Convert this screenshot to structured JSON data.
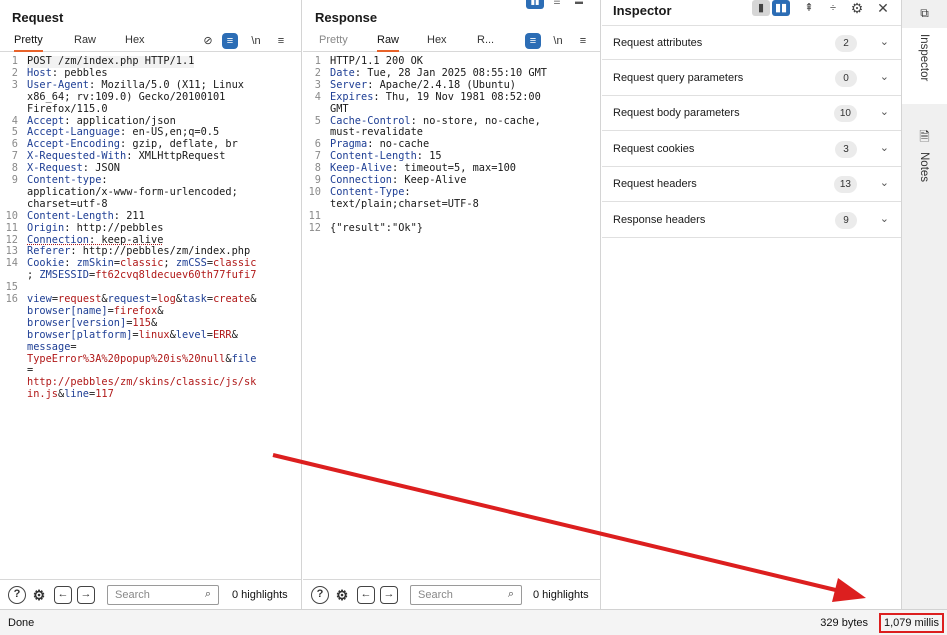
{
  "request": {
    "title": "Request",
    "tabs": [
      "Pretty",
      "Raw",
      "Hex"
    ],
    "tools": {
      "newline": "\\n",
      "menu": "≡"
    },
    "lines": [
      {
        "n": "1",
        "html": "POST /zm/index.php HTTP/1.1"
      },
      {
        "n": "2",
        "html": "<span class='k'>Host</span>: pebbles"
      },
      {
        "n": "3",
        "html": "<span class='k'>User-Agent</span>: Mozilla/5.0 (X11; Linux"
      },
      {
        "n": "",
        "html": "x86_64; rv:109.0) Gecko/20100101"
      },
      {
        "n": "",
        "html": "Firefox/115.0"
      },
      {
        "n": "4",
        "html": "<span class='k'>Accept</span>: application/json"
      },
      {
        "n": "5",
        "html": "<span class='k'>Accept-Language</span>: en-US,en;q=0.5"
      },
      {
        "n": "6",
        "html": "<span class='k'>Accept-Encoding</span>: gzip, deflate, br"
      },
      {
        "n": "7",
        "html": "<span class='k'>X-Requested-With</span>: XMLHttpRequest"
      },
      {
        "n": "8",
        "html": "<span class='k'>X-Request</span>: JSON"
      },
      {
        "n": "9",
        "html": "<span class='k'>Content-type</span>:"
      },
      {
        "n": "",
        "html": "application/x-www-form-urlencoded;"
      },
      {
        "n": "",
        "html": "charset=utf-8"
      },
      {
        "n": "10",
        "html": "<span class='k'>Content-Length</span>: 211"
      },
      {
        "n": "11",
        "html": "<span class='k'>Origin</span>: http://pebbles"
      },
      {
        "n": "12",
        "html": "<span class='k ul'>Connection</span><span class='ul'>: keep-alive</span>"
      },
      {
        "n": "13",
        "html": "<span class='k'>Referer</span>: http://pebbles/zm/index.php"
      },
      {
        "n": "14",
        "html": "<span class='k'>Cookie</span>: <span class='k'>zmSkin</span>=<span class='r'>classic</span>; <span class='k'>zmCSS</span>=<span class='r'>classic</span>"
      },
      {
        "n": "",
        "html": "; <span class='k'>ZMSESSID</span>=<span class='r'>ft62cvq8ldecuev60th77fufi7</span>"
      },
      {
        "n": "15",
        "html": ""
      },
      {
        "n": "16",
        "html": "<span class='k'>view</span>=<span class='r'>request</span>&amp;<span class='k'>request</span>=<span class='r'>log</span>&amp;<span class='k'>task</span>=<span class='r'>create</span>&amp;"
      },
      {
        "n": "",
        "html": "<span class='k'>browser[name]</span>=<span class='r'>firefox</span>&amp;"
      },
      {
        "n": "",
        "html": "<span class='k'>browser[version]</span>=<span class='r'>115</span>&amp;"
      },
      {
        "n": "",
        "html": "<span class='k'>browser[platform]</span>=<span class='r'>linux</span>&amp;<span class='k'>level</span>=<span class='r'>ERR</span>&amp;"
      },
      {
        "n": "",
        "html": "<span class='k'>message</span>="
      },
      {
        "n": "",
        "html": "<span class='r'>TypeError%3A%20popup%20is%20null</span>&amp;<span class='k'>file</span>"
      },
      {
        "n": "",
        "html": "="
      },
      {
        "n": "",
        "html": "<span class='r'>http://pebbles/zm/skins/classic/js/sk</span>"
      },
      {
        "n": "",
        "html": "<span class='r'>in.js</span>&amp;<span class='k'>line</span>=<span class='r'>117</span>"
      }
    ],
    "search_placeholder": "Search",
    "highlights": "0 highlights"
  },
  "response": {
    "title": "Response",
    "tabs": [
      "Pretty",
      "Raw",
      "Hex",
      "R..."
    ],
    "tools": {
      "newline": "\\n",
      "menu": "≡"
    },
    "lines": [
      {
        "n": "1",
        "html": "HTTP/1.1 200 OK"
      },
      {
        "n": "2",
        "html": "<span class='k'>Date</span>: Tue, 28 Jan 2025 08:55:10 GMT"
      },
      {
        "n": "3",
        "html": "<span class='k'>Server</span>: Apache/2.4.18 (Ubuntu)"
      },
      {
        "n": "4",
        "html": "<span class='k'>Expires</span>: Thu, 19 Nov 1981 08:52:00"
      },
      {
        "n": "",
        "html": "GMT"
      },
      {
        "n": "5",
        "html": "<span class='k'>Cache-Control</span>: no-store, no-cache,"
      },
      {
        "n": "",
        "html": "must-revalidate"
      },
      {
        "n": "6",
        "html": "<span class='k'>Pragma</span>: no-cache"
      },
      {
        "n": "7",
        "html": "<span class='k'>Content-Length</span>: 15"
      },
      {
        "n": "8",
        "html": "<span class='k'>Keep-Alive</span>: timeout=5, max=100"
      },
      {
        "n": "9",
        "html": "<span class='k'>Connection</span>: Keep-Alive"
      },
      {
        "n": "10",
        "html": "<span class='k'>Content-Type</span>:"
      },
      {
        "n": "",
        "html": "text/plain;charset=UTF-8"
      },
      {
        "n": "11",
        "html": ""
      },
      {
        "n": "12",
        "html": "{\"result\":\"Ok\"}"
      }
    ],
    "search_placeholder": "Search",
    "highlights": "0 highlights"
  },
  "inspector": {
    "title": "Inspector",
    "rows": [
      {
        "label": "Request attributes",
        "count": "2"
      },
      {
        "label": "Request query parameters",
        "count": "0"
      },
      {
        "label": "Request body parameters",
        "count": "10"
      },
      {
        "label": "Request cookies",
        "count": "3"
      },
      {
        "label": "Request headers",
        "count": "13"
      },
      {
        "label": "Response headers",
        "count": "9"
      }
    ]
  },
  "side_rail": {
    "tabs": [
      "Inspector",
      "Notes"
    ]
  },
  "status": {
    "left": "Done",
    "bytes": "329 bytes",
    "millis": "1,079 millis"
  },
  "annotation": {
    "color": "#dc1f1f"
  },
  "colors": {
    "accent": "#2c6db5",
    "tab_underline": "#e8632b",
    "header_name": "#1f3f95",
    "value": "#b01818"
  }
}
